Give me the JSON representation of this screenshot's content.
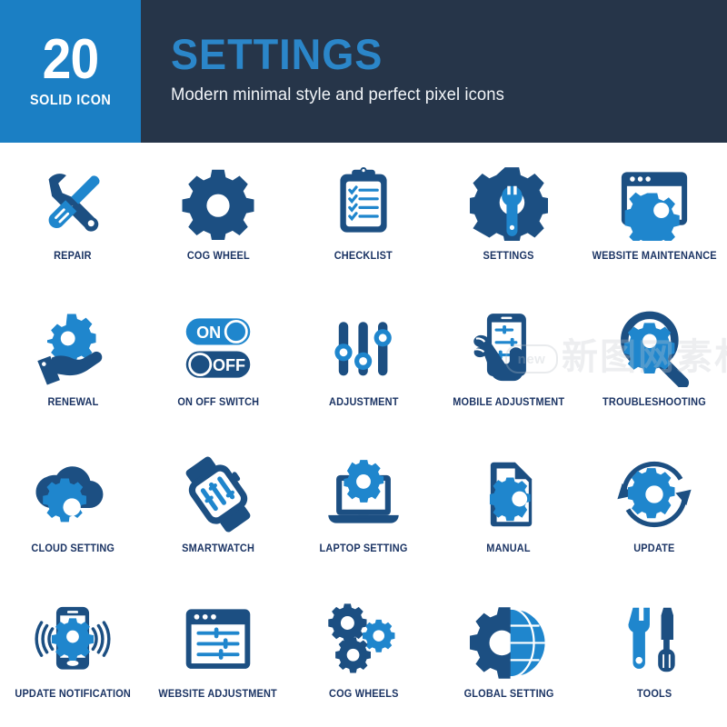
{
  "header": {
    "badge_number": "20",
    "badge_subtitle": "SOLID ICON",
    "title": "SETTINGS",
    "subtitle": "Modern minimal style and perfect pixel icons",
    "badge_bg": "#1b7fc4",
    "header_bg": "#263549",
    "title_color": "#2b86c9"
  },
  "palette": {
    "dark_blue": "#1c4f82",
    "light_blue": "#1f86cd",
    "label_color": "#1b3464",
    "white": "#ffffff"
  },
  "watermark": {
    "badge_text": "new",
    "cn_text": "新图网素材"
  },
  "icons": [
    {
      "id": "repair",
      "label": "REPAIR"
    },
    {
      "id": "cog-wheel",
      "label": "COG WHEEL"
    },
    {
      "id": "checklist",
      "label": "CHECKLIST"
    },
    {
      "id": "settings",
      "label": "SETTINGS"
    },
    {
      "id": "website-maintenance",
      "label": "WEBSITE MAINTENANCE"
    },
    {
      "id": "renewal",
      "label": "RENEWAL"
    },
    {
      "id": "on-off-switch",
      "label": "ON OFF SWITCH"
    },
    {
      "id": "adjustment",
      "label": "ADJUSTMENT"
    },
    {
      "id": "mobile-adjustment",
      "label": "MOBILE ADJUSTMENT"
    },
    {
      "id": "troubleshooting",
      "label": "TROUBLESHOOTING"
    },
    {
      "id": "cloud-setting",
      "label": "CLOUD SETTING"
    },
    {
      "id": "smartwatch",
      "label": "SMARTWATCH"
    },
    {
      "id": "laptop-setting",
      "label": "LAPTOP SETTING"
    },
    {
      "id": "manual",
      "label": "MANUAL"
    },
    {
      "id": "update",
      "label": "UPDATE"
    },
    {
      "id": "update-notification",
      "label": "UPDATE NOTIFICATION"
    },
    {
      "id": "website-adjustment",
      "label": "WEBSITE ADJUSTMENT"
    },
    {
      "id": "cog-wheels",
      "label": "COG WHEELS"
    },
    {
      "id": "global-setting",
      "label": "GLOBAL SETTING"
    },
    {
      "id": "tools",
      "label": "TOOLS"
    }
  ],
  "switch_labels": {
    "on": "ON",
    "off": "OFF"
  }
}
